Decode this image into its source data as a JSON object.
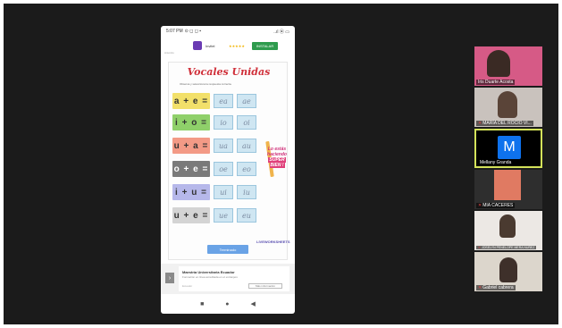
{
  "phone": {
    "status": {
      "time": "5:07 PM",
      "icons": "⊙ ◻ ◻ ▪",
      "right": "..ıl ⦿ ▭"
    },
    "ad": {
      "name": "Invitel",
      "stars": "★★★★★",
      "button": "INSTALAR",
      "small": "Anuncio"
    },
    "sheet": {
      "title": "Vocales Unidas",
      "instruction": "Observa y selecciona la respuesta correcta.",
      "rows": [
        {
          "eq": "a + e =",
          "answers": [
            "ea",
            "ae"
          ]
        },
        {
          "eq": "i + o =",
          "answers": [
            "io",
            "oi"
          ]
        },
        {
          "eq": "u + a =",
          "answers": [
            "ua",
            "au"
          ]
        },
        {
          "eq": "o + e =",
          "answers": [
            "oe",
            "eo"
          ]
        },
        {
          "eq": "i + u =",
          "answers": [
            "ui",
            "iu"
          ]
        },
        {
          "eq": "u + e =",
          "answers": [
            "ue",
            "eu"
          ]
        }
      ],
      "badge_top": "Lo estás",
      "badge_mid": "haciendo",
      "badge_hi1": "SUPER",
      "badge_hi2": "BIEN !",
      "brand": "LIVEWORKSHEETS",
      "finish": "Terminado"
    },
    "bottom_ad": {
      "arrow": "›",
      "title": "Maestría Universitaria Ecuador",
      "sub": "Formación en línea acreditada en el extranjero",
      "input": "Ecuador",
      "button": "Más información"
    },
    "nav": {
      "stop": "■",
      "home": "●",
      "back": "◀"
    }
  },
  "participants": [
    {
      "name": "Iris Duarte Acosta",
      "muted": false
    },
    {
      "name": "MARÍA DEL ROCÍO VI...",
      "muted": true
    },
    {
      "name": "Mellany Granda",
      "muted": false,
      "initial": "M",
      "active": true
    },
    {
      "name": "MIA CACERES",
      "muted": true
    },
    {
      "name": "JOSELYN PENELOPE MERA NUÑEZ",
      "muted": true
    },
    {
      "name": "Gabriel cabrera",
      "muted": true
    }
  ],
  "colors": {
    "row_colors": [
      "#f2e06a",
      "#8fd06a",
      "#f39a86",
      "#7a7a7a",
      "#b6b8ea",
      "#d4d4d4"
    ],
    "active_border": "#d4e25a",
    "avatar": "#0e72ed"
  }
}
